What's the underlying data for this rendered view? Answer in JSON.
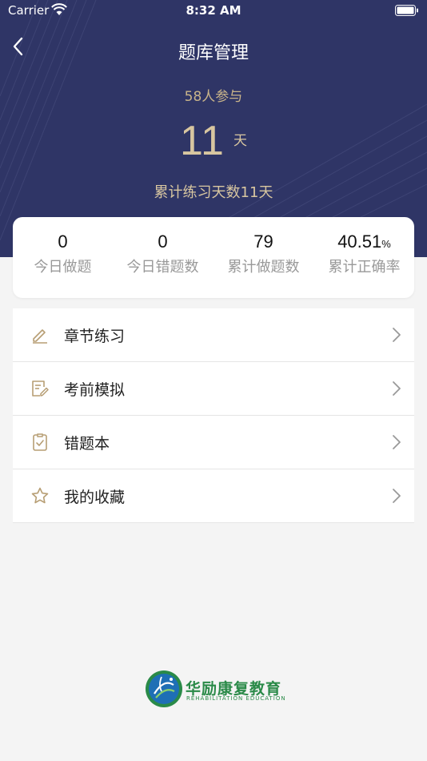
{
  "status": {
    "carrier": "Carrier",
    "time": "8:32 AM"
  },
  "nav": {
    "title": "题库管理"
  },
  "hero": {
    "participants": "58人参与",
    "days": "11",
    "days_unit": "天",
    "total_days": "累计练习天数11天"
  },
  "stats": [
    {
      "value": "0",
      "suffix": "",
      "label": "今日做题"
    },
    {
      "value": "0",
      "suffix": "",
      "label": "今日错题数"
    },
    {
      "value": "79",
      "suffix": "",
      "label": "累计做题数"
    },
    {
      "value": "40.51",
      "suffix": "%",
      "label": "累计正确率"
    }
  ],
  "menu": [
    {
      "label": "章节练习",
      "icon": "pencil-icon"
    },
    {
      "label": "考前模拟",
      "icon": "document-edit-icon"
    },
    {
      "label": "错题本",
      "icon": "checklist-icon"
    },
    {
      "label": "我的收藏",
      "icon": "star-icon"
    }
  ],
  "logo": {
    "name": "华励康复教育",
    "subtitle": "REHABILITATION EDUCATION"
  },
  "colors": {
    "header": "#2f3566",
    "accent": "#c9b48a",
    "logo": "#2a8a48"
  }
}
